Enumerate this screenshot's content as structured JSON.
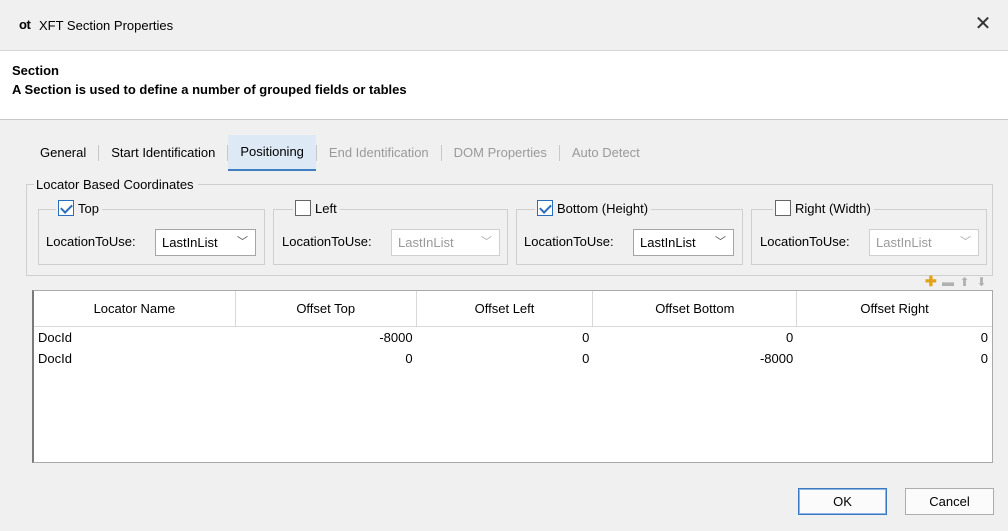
{
  "window": {
    "logo_text": "ot",
    "title": "XFT Section Properties",
    "close_glyph": "✕"
  },
  "header": {
    "title": "Section",
    "description": "A Section is used to define a number of grouped fields or tables"
  },
  "tabs": [
    {
      "label": "General",
      "state": "normal"
    },
    {
      "label": "Start Identification",
      "state": "normal"
    },
    {
      "label": "Positioning",
      "state": "active"
    },
    {
      "label": "End Identification",
      "state": "disabled"
    },
    {
      "label": "DOM Properties",
      "state": "disabled"
    },
    {
      "label": "Auto Detect",
      "state": "disabled"
    }
  ],
  "locator_group": {
    "label": "Locator Based Coordinates",
    "location_label": "LocationToUse:",
    "boxes": [
      {
        "label": "Top",
        "checked": true,
        "value": "LastInList",
        "enabled": true
      },
      {
        "label": "Left",
        "checked": false,
        "value": "LastInList",
        "enabled": false
      },
      {
        "label": "Bottom (Height)",
        "checked": true,
        "value": "LastInList",
        "enabled": true
      },
      {
        "label": "Right (Width)",
        "checked": false,
        "value": "LastInList",
        "enabled": false
      }
    ]
  },
  "toolbar": {
    "icons": [
      "add-icon",
      "remove-icon",
      "move-up-icon",
      "move-down-icon"
    ]
  },
  "table": {
    "columns": [
      "Locator Name",
      "Offset Top",
      "Offset Left",
      "Offset Bottom",
      "Offset Right"
    ],
    "rows": [
      [
        "DocId",
        "-8000",
        "0",
        "0",
        "0"
      ],
      [
        "DocId",
        "0",
        "0",
        "-8000",
        "0"
      ]
    ]
  },
  "buttons": {
    "ok": "OK",
    "cancel": "Cancel"
  },
  "colors": {
    "accent": "#3d7fc1",
    "active_tab_bg": "#dde9f5",
    "add_icon": "#e3a21a"
  }
}
